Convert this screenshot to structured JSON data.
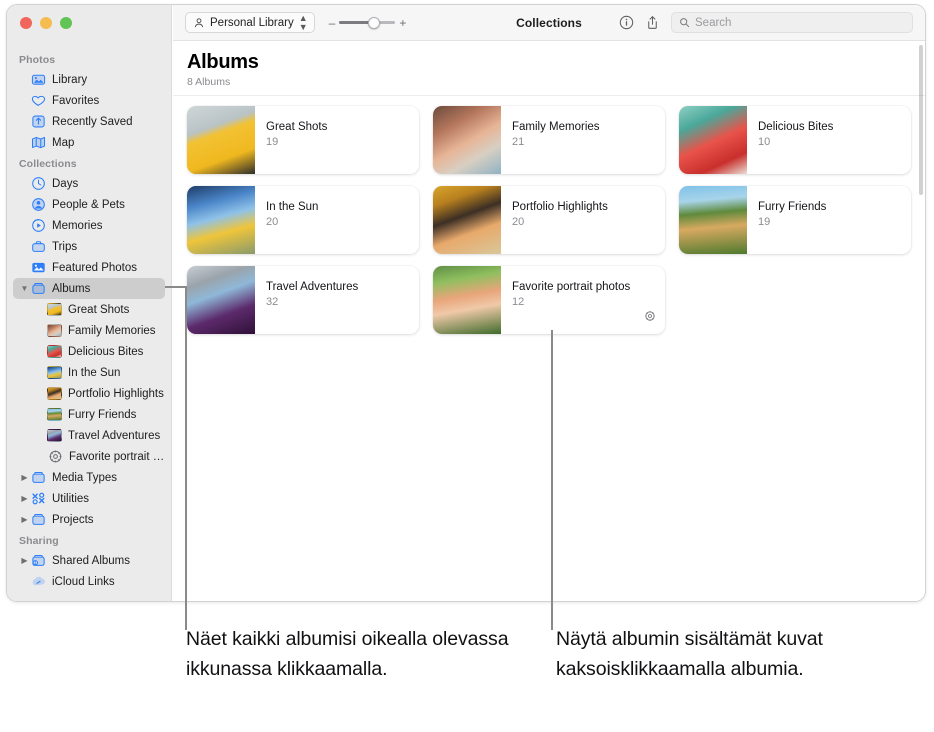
{
  "window": {
    "traffic_lights": [
      "close",
      "minimize",
      "zoom"
    ],
    "toolbar": {
      "library_button": "Personal Library",
      "zoom_out_label": "–",
      "zoom_in_label": "+",
      "title": "Collections",
      "info_icon": "info-icon",
      "share_icon": "share-icon",
      "search_placeholder": "Search",
      "search_value": ""
    }
  },
  "sidebar": {
    "sections": [
      {
        "header": "Photos",
        "items": [
          {
            "label": "Library",
            "icon": "library-icon",
            "indent": 0,
            "chevron": "",
            "selected": false
          },
          {
            "label": "Favorites",
            "icon": "heart-icon",
            "indent": 0,
            "chevron": "",
            "selected": false
          },
          {
            "label": "Recently Saved",
            "icon": "recently-saved-icon",
            "indent": 0,
            "chevron": "",
            "selected": false
          },
          {
            "label": "Map",
            "icon": "map-icon",
            "indent": 0,
            "chevron": "",
            "selected": false
          }
        ]
      },
      {
        "header": "Collections",
        "items": [
          {
            "label": "Days",
            "icon": "clock-icon",
            "indent": 0,
            "chevron": "",
            "selected": false
          },
          {
            "label": "People & Pets",
            "icon": "person-circle-icon",
            "indent": 0,
            "chevron": "",
            "selected": false
          },
          {
            "label": "Memories",
            "icon": "memories-play-icon",
            "indent": 0,
            "chevron": "",
            "selected": false
          },
          {
            "label": "Trips",
            "icon": "trips-icon",
            "indent": 0,
            "chevron": "",
            "selected": false
          },
          {
            "label": "Featured Photos",
            "icon": "featured-photos-icon",
            "indent": 0,
            "chevron": "",
            "selected": false
          },
          {
            "label": "Albums",
            "icon": "albums-folder-icon",
            "indent": 0,
            "chevron": "down",
            "selected": true
          },
          {
            "label": "Great Shots",
            "icon": "album-thumb-great-shots",
            "indent": 1,
            "chevron": "",
            "selected": false
          },
          {
            "label": "Family Memories",
            "icon": "album-thumb-family-memories",
            "indent": 1,
            "chevron": "",
            "selected": false
          },
          {
            "label": "Delicious Bites",
            "icon": "album-thumb-delicious-bites",
            "indent": 1,
            "chevron": "",
            "selected": false
          },
          {
            "label": "In the Sun",
            "icon": "album-thumb-in-the-sun",
            "indent": 1,
            "chevron": "",
            "selected": false
          },
          {
            "label": "Portfolio Highlights",
            "icon": "album-thumb-portfolio-highlights",
            "indent": 1,
            "chevron": "",
            "selected": false
          },
          {
            "label": "Furry Friends",
            "icon": "album-thumb-furry-friends",
            "indent": 1,
            "chevron": "",
            "selected": false
          },
          {
            "label": "Travel Adventures",
            "icon": "album-thumb-travel-adventures",
            "indent": 1,
            "chevron": "",
            "selected": false
          },
          {
            "label": "Favorite portrait photos",
            "icon": "smart-album-gear-icon",
            "indent": 1,
            "chevron": "",
            "selected": false
          },
          {
            "label": "Media Types",
            "icon": "media-types-folder-icon",
            "indent": 0,
            "chevron": "right",
            "selected": false
          },
          {
            "label": "Utilities",
            "icon": "utilities-icon",
            "indent": 0,
            "chevron": "right",
            "selected": false
          },
          {
            "label": "Projects",
            "icon": "projects-folder-icon",
            "indent": 0,
            "chevron": "right",
            "selected": false
          }
        ]
      },
      {
        "header": "Sharing",
        "items": [
          {
            "label": "Shared Albums",
            "icon": "shared-albums-icon",
            "indent": 0,
            "chevron": "right",
            "selected": false
          },
          {
            "label": "iCloud Links",
            "icon": "icloud-links-icon",
            "indent": 0,
            "chevron": "",
            "selected": false
          }
        ]
      }
    ]
  },
  "main": {
    "title": "Albums",
    "subtitle": "8 Albums",
    "albums": [
      {
        "name": "Great Shots",
        "count": "19",
        "badge": ""
      },
      {
        "name": "Family Memories",
        "count": "21",
        "badge": ""
      },
      {
        "name": "Delicious Bites",
        "count": "10",
        "badge": ""
      },
      {
        "name": "In the Sun",
        "count": "20",
        "badge": ""
      },
      {
        "name": "Portfolio Highlights",
        "count": "20",
        "badge": ""
      },
      {
        "name": "Furry Friends",
        "count": "19",
        "badge": ""
      },
      {
        "name": "Travel Adventures",
        "count": "32",
        "badge": ""
      },
      {
        "name": "Favorite portrait photos",
        "count": "12",
        "badge": "smart-album-gear-icon"
      }
    ]
  },
  "callouts": [
    {
      "text": "Näet kaikki albumisi oikealla olevassa ikkunassa klikkaamalla."
    },
    {
      "text": "Näytä albumin sisältämät kuvat kaksoisklikkaamalla albumia."
    }
  ],
  "colors": {
    "accent": "#2d7ff9",
    "sidebar_bg": "#ebebeb",
    "selection": "#cdcdcd",
    "leader_line": "#8a8a8a"
  }
}
